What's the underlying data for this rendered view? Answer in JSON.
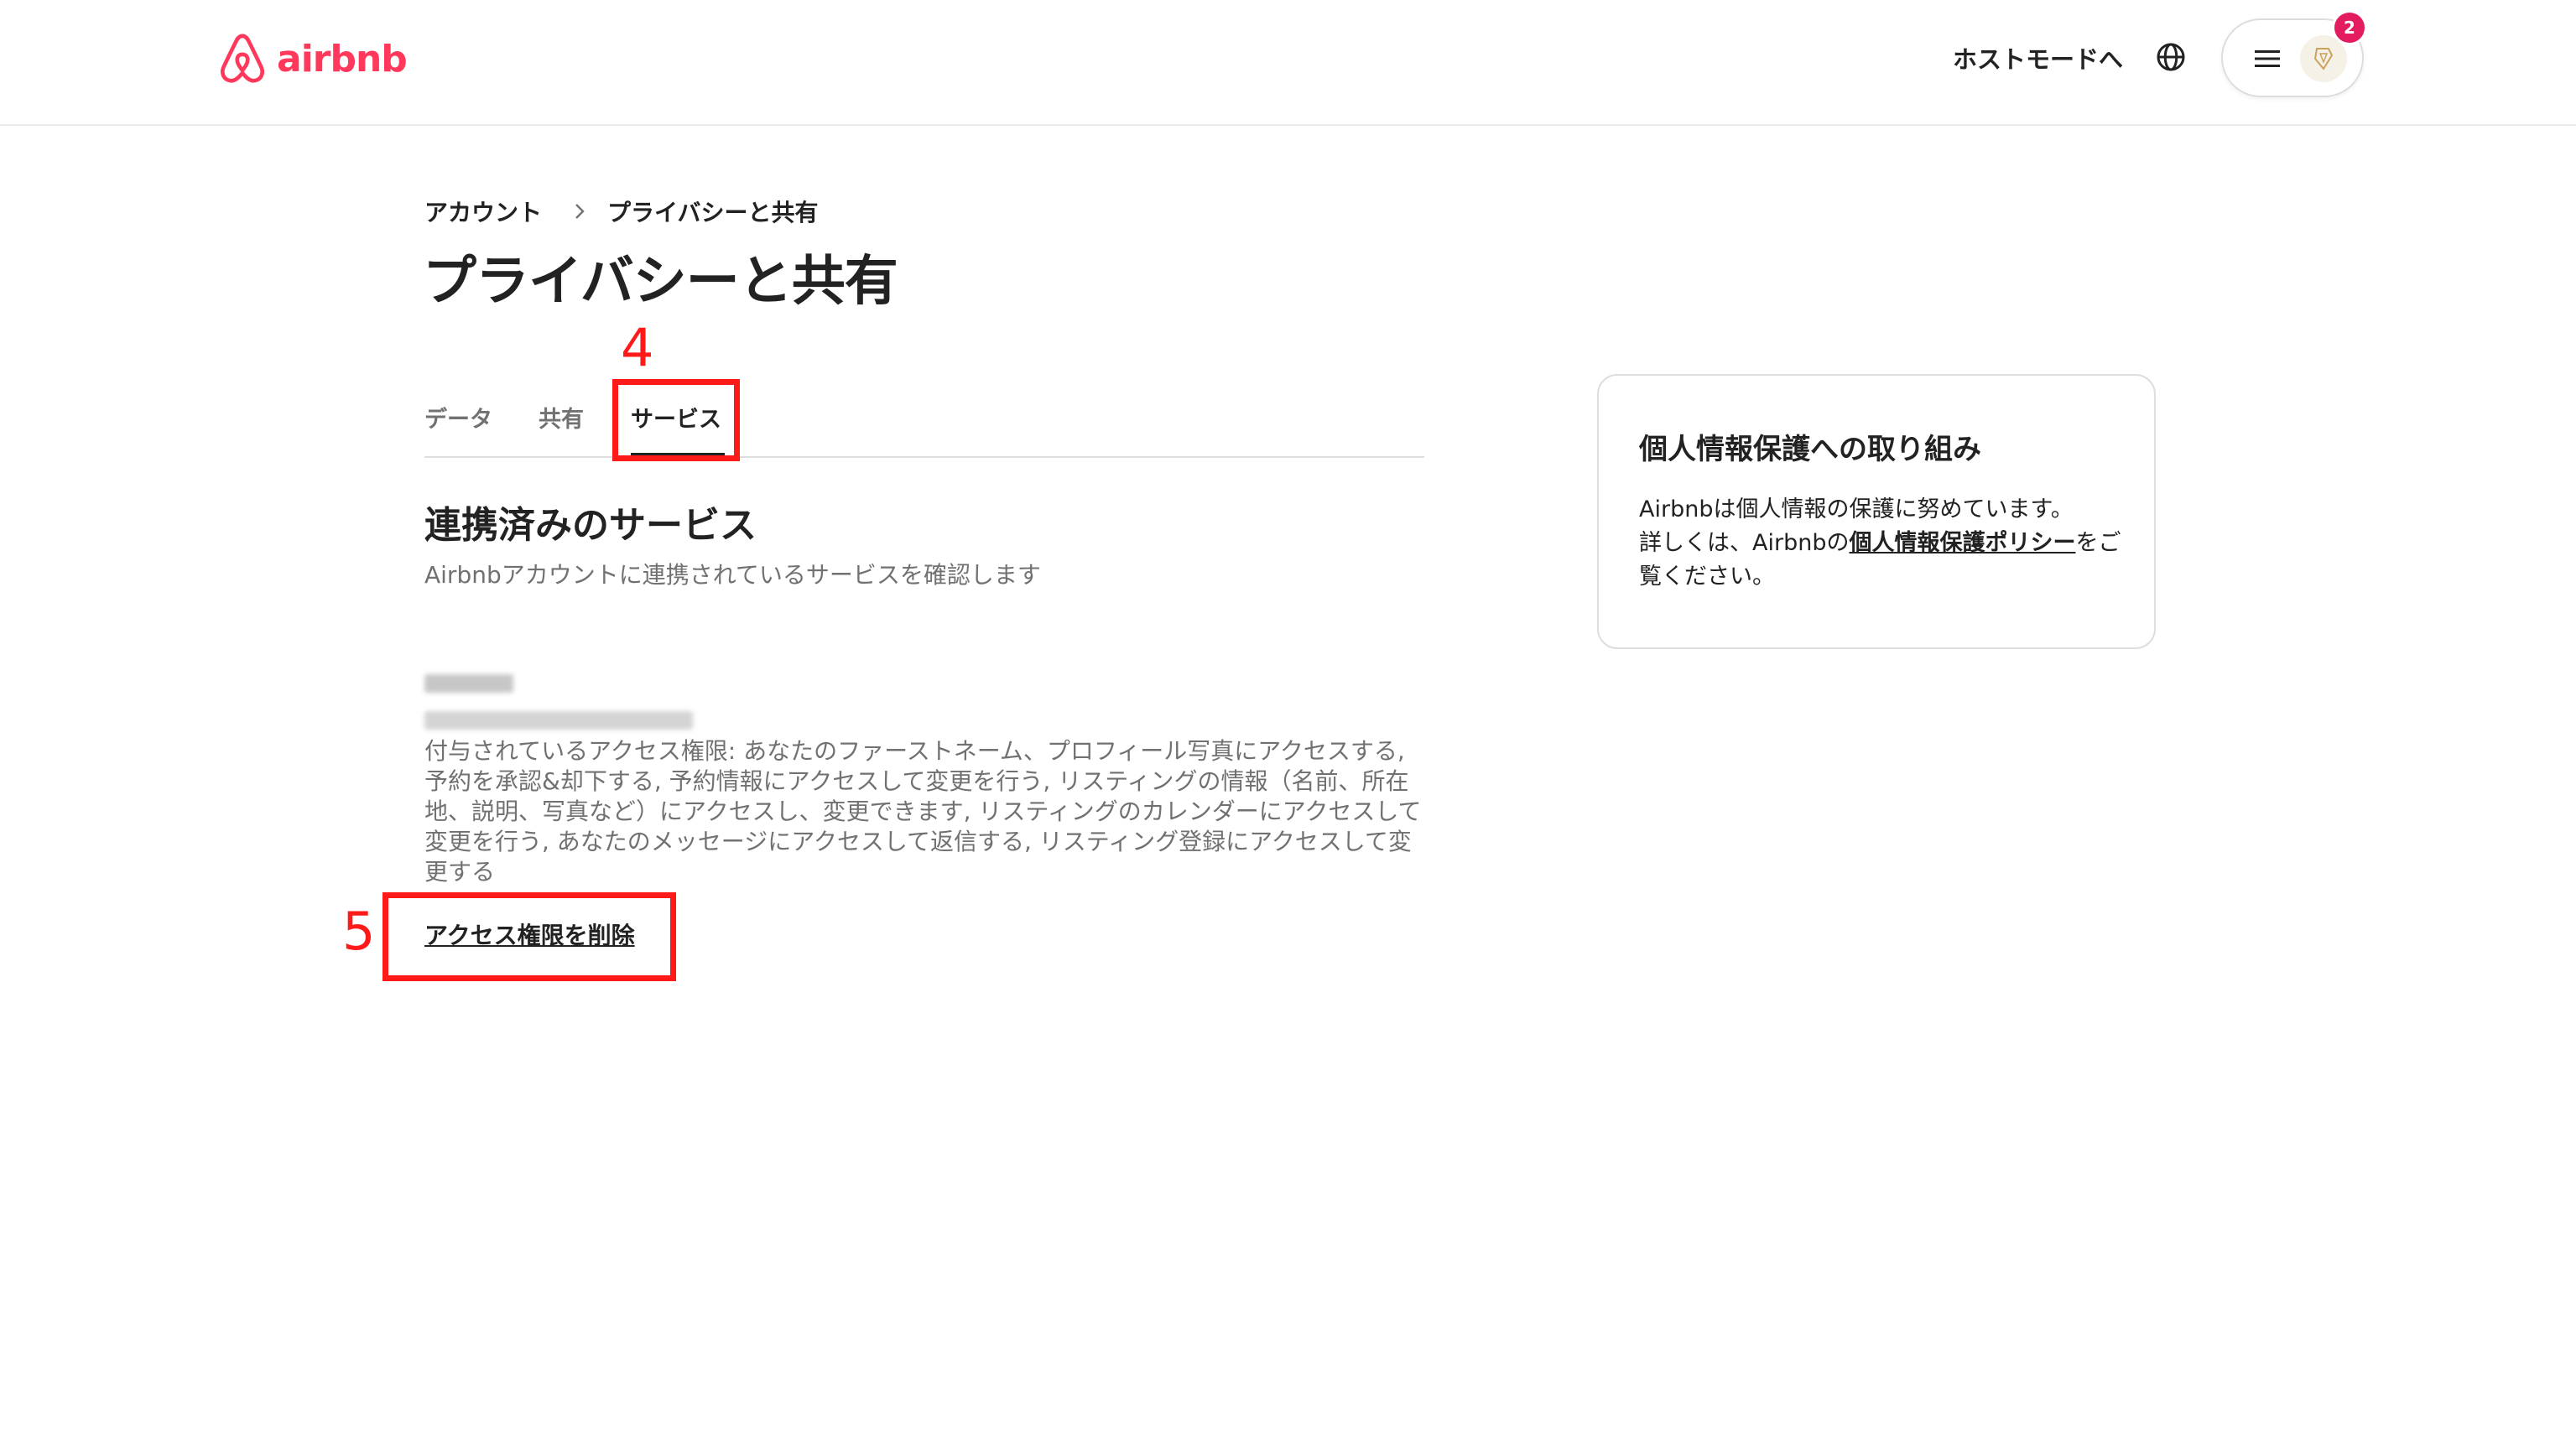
{
  "header": {
    "brand": "airbnb",
    "brand_color": "#FF385C",
    "host_mode_label": "ホストモードへ",
    "globe_icon": "globe-icon",
    "menu_icon": "hamburger-icon",
    "notification_count": "2"
  },
  "breadcrumb": {
    "items": [
      "アカウント",
      "プライバシーと共有"
    ]
  },
  "page": {
    "title": "プライバシーと共有"
  },
  "tabs": [
    {
      "label": "データ",
      "active": false
    },
    {
      "label": "共有",
      "active": false
    },
    {
      "label": "サービス",
      "active": true
    }
  ],
  "services": {
    "title": "連携済みのサービス",
    "subtitle": "Airbnbアカウントに連携されているサービスを確認します",
    "permissions_text": "付与されているアクセス権限: あなたのファーストネーム、プロフィール写真にアクセスする, 予約を承認&却下する, 予約情報にアクセスして変更を行う, リスティングの情報（名前、所在地、説明、写真など）にアクセスし、変更できます, リスティングのカレンダーにアクセスして変更を行う, あなたのメッセージにアクセスして返信する, リスティング登録にアクセスして変更する",
    "remove_access_label": "アクセス権限を削除"
  },
  "annotations": {
    "step_4": "4",
    "step_5": "5",
    "highlight_color": "#FF1A1A"
  },
  "privacy_card": {
    "title": "個人情報保護への取り組み",
    "body_line1": "Airbnbは個人情報の保護に努めています。",
    "body_prefix": "詳しくは、Airbnbの",
    "policy_link": "個人情報保護ポリシー",
    "body_suffix": "をご覧ください。"
  }
}
